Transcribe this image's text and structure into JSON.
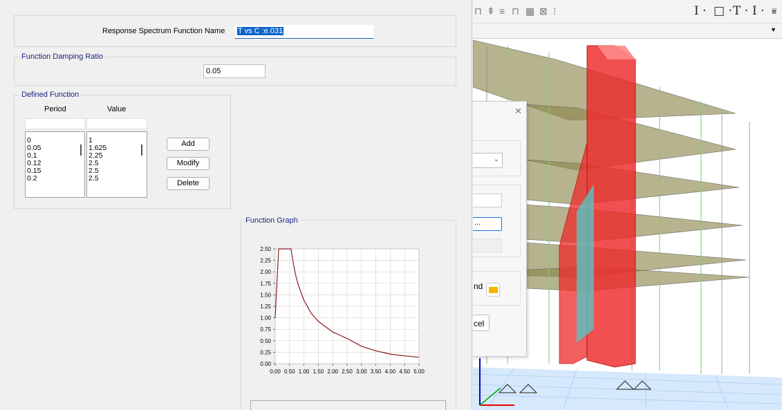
{
  "dialog": {
    "name_label": "Response Spectrum Function Name",
    "name_value": "T vs C :e.031",
    "damping_title": "Function Damping Ratio",
    "damping_value": "0.05",
    "defined_title": "Defined Function",
    "col_period": "Period",
    "col_value": "Value",
    "periods": [
      "0",
      "0.05",
      "0.1",
      "0.12",
      "0.15",
      "0.2"
    ],
    "values": [
      "1",
      "1.625",
      "2.25",
      "2.5",
      "2.5",
      "2.5"
    ],
    "add_label": "Add",
    "modify_label": "Modify",
    "delete_label": "Delete",
    "graph_title": "Function Graph"
  },
  "chart_data": {
    "type": "line",
    "title": "",
    "xlabel": "",
    "ylabel": "",
    "x": [
      0,
      0.05,
      0.1,
      0.12,
      0.15,
      0.2,
      0.3,
      0.4,
      0.5,
      0.55,
      0.6,
      0.7,
      0.8,
      1.0,
      1.25,
      1.5,
      2.0,
      2.5,
      3.0,
      3.5,
      4.0,
      4.5,
      5.0
    ],
    "series": [
      {
        "values": [
          1.0,
          1.625,
          2.25,
          2.5,
          2.5,
          2.5,
          2.5,
          2.5,
          2.5,
          2.5,
          2.29,
          1.96,
          1.72,
          1.38,
          1.1,
          0.92,
          0.69,
          0.55,
          0.38,
          0.28,
          0.21,
          0.17,
          0.14
        ]
      }
    ],
    "x_ticks": [
      "0.00",
      "0.50",
      "1.00",
      "1.50",
      "2.00",
      "2.50",
      "3.00",
      "3.50",
      "4.00",
      "4.50",
      "5.00"
    ],
    "y_ticks": [
      "0.00",
      "0.25",
      "0.50",
      "0.75",
      "1.00",
      "1.25",
      "1.50",
      "1.75",
      "2.00",
      "2.25",
      "2.50"
    ],
    "xlim": [
      0,
      5
    ],
    "ylim": [
      0,
      2.5
    ],
    "grid": true,
    "line_color": "#8b1a1a"
  },
  "right_panel": {
    "close_glyph": "✕",
    "partial_text_1": "nd",
    "partial_text_2": "cel",
    "partial_text_3": "..."
  }
}
